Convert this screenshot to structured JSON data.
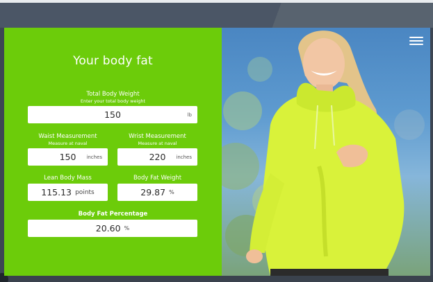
{
  "calculator": {
    "title": "Your body fat",
    "total_weight": {
      "label": "Total Body Weight",
      "sub": "Enter your total body weight",
      "value": "150",
      "unit": "lb"
    },
    "waist": {
      "label": "Waist Measurement",
      "sub": "Measure at naval",
      "value": "150",
      "unit": "inches"
    },
    "wrist": {
      "label": "Wrist Measurement",
      "sub": "Measure at naval",
      "value": "220",
      "unit": "inches"
    },
    "lean_mass": {
      "label": "Lean Body Mass",
      "value": "115.13",
      "unit": "points"
    },
    "fat_weight": {
      "label": "Body Fat Weight",
      "value": "29.87",
      "unit": "%"
    },
    "fat_percentage": {
      "label": "Body Fat Percentage",
      "value": "20.60",
      "unit": "%"
    }
  },
  "menu": {
    "icon": "hamburger-menu-icon"
  },
  "colors": {
    "panel_green": "#6ccc0a",
    "frame": "#4b5666",
    "input_bg": "#ffffff"
  }
}
